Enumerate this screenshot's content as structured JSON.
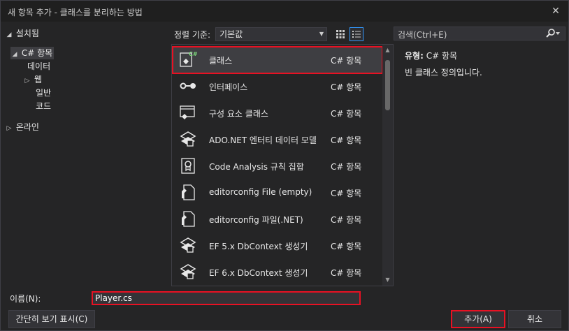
{
  "window": {
    "title": "새 항목 추가 - 클래스를 분리하는 방법",
    "close_glyph": "✕"
  },
  "tree": [
    {
      "label": "설치됨",
      "caret": "◢"
    },
    {
      "label": "C# 항목",
      "caret": "◢"
    },
    {
      "label": "데이터",
      "caret": ""
    },
    {
      "label": "웹",
      "caret": "▷"
    },
    {
      "label": "일반",
      "caret": ""
    },
    {
      "label": "코드",
      "caret": ""
    },
    {
      "label": "온라인",
      "caret": "▷"
    }
  ],
  "sort": {
    "label": "정렬 기준:",
    "value": "기본값",
    "dropdown_glyph": "▼"
  },
  "search": {
    "placeholder": "검색(Ctrl+E)",
    "icon": "search-icon"
  },
  "templates": [
    {
      "name": "클래스",
      "type": "C# 항목",
      "icon": "class-icon"
    },
    {
      "name": "인터페이스",
      "type": "C# 항목",
      "icon": "interface-icon"
    },
    {
      "name": "구성 요소 클래스",
      "type": "C# 항목",
      "icon": "component-class-icon"
    },
    {
      "name": "ADO.NET 엔터티 데이터 모델",
      "type": "C# 항목",
      "icon": "entity-model-icon"
    },
    {
      "name": "Code Analysis 규칙 집합",
      "type": "C# 항목",
      "icon": "ruleset-icon"
    },
    {
      "name": "editorconfig File (empty)",
      "type": "C# 항목",
      "icon": "editorconfig-icon"
    },
    {
      "name": "editorconfig 파일(.NET)",
      "type": "C# 항목",
      "icon": "editorconfig-icon"
    },
    {
      "name": "EF 5.x DbContext 생성기",
      "type": "C# 항목",
      "icon": "dbcontext-icon"
    },
    {
      "name": "EF 6.x DbContext 생성기",
      "type": "C# 항목",
      "icon": "dbcontext-icon"
    }
  ],
  "details": {
    "type_label": "유형:",
    "type_value": "C# 항목",
    "description": "빈 클래스 정의입니다."
  },
  "name_field": {
    "label": "이름(N):",
    "value": "Player.cs"
  },
  "buttons": {
    "compact_view": "간단히 보기 표시(C)",
    "add": "추가(A)",
    "cancel": "취소"
  },
  "colors": {
    "accent": "#3399ff",
    "highlight": "#e81123",
    "background": "#252526",
    "csharp_badge": "#7dd87d"
  }
}
